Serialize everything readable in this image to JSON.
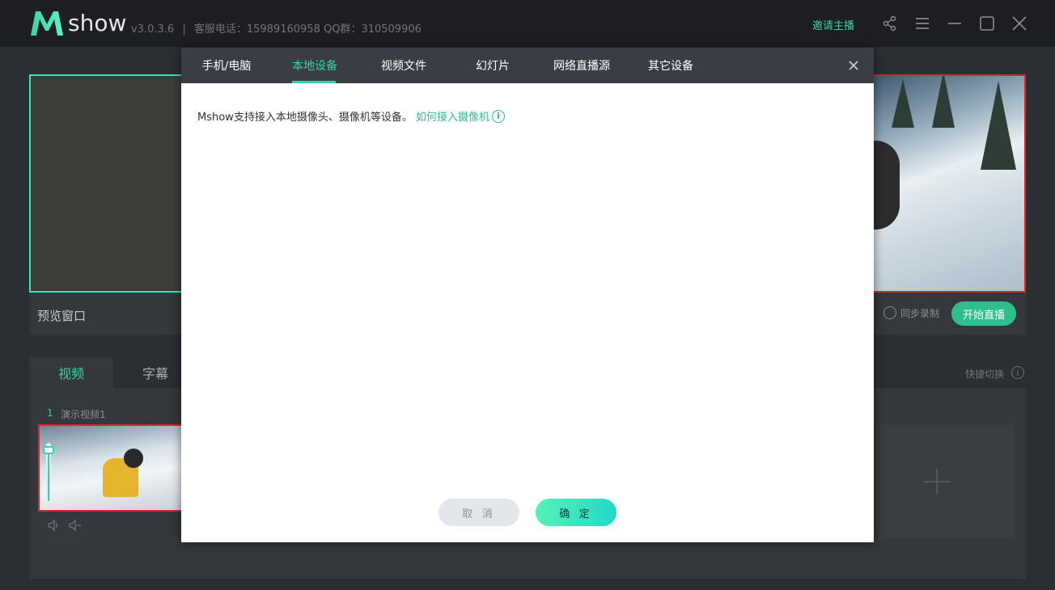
{
  "titlebar": {
    "logo_text": "show",
    "version": "v3.0.3.6",
    "separator": "|",
    "service_phone": "客服电话：15989160958 QQ群：310509906",
    "invite_host": "邀请主播"
  },
  "preview": {
    "label": "预览窗口"
  },
  "live": {
    "sync_record_label": "同步录制",
    "start_live_label": "开始直播"
  },
  "source_panel": {
    "tabs": [
      {
        "label": "视频"
      },
      {
        "label": "字幕"
      }
    ],
    "quick_switch_label": "快捷切换",
    "source_index": "1",
    "source_name": "演示视频1"
  },
  "modal": {
    "tabs": [
      {
        "label": "手机/电脑"
      },
      {
        "label": "本地设备"
      },
      {
        "label": "视频文件"
      },
      {
        "label": "幻灯片"
      },
      {
        "label": "网络直播源"
      },
      {
        "label": "其它设备"
      }
    ],
    "active_tab": "本地设备",
    "description": "Mshow支持接入本地摄像头、摄像机等设备。",
    "help_link": "如何接入摄像机",
    "cancel_label": "取 消",
    "ok_label": "确 定"
  },
  "colors": {
    "accent": "#2fd5a3",
    "live_border": "#e0242c",
    "titlebar_bg": "#1c1e21",
    "modal_tab_bg": "#3a3e44"
  }
}
